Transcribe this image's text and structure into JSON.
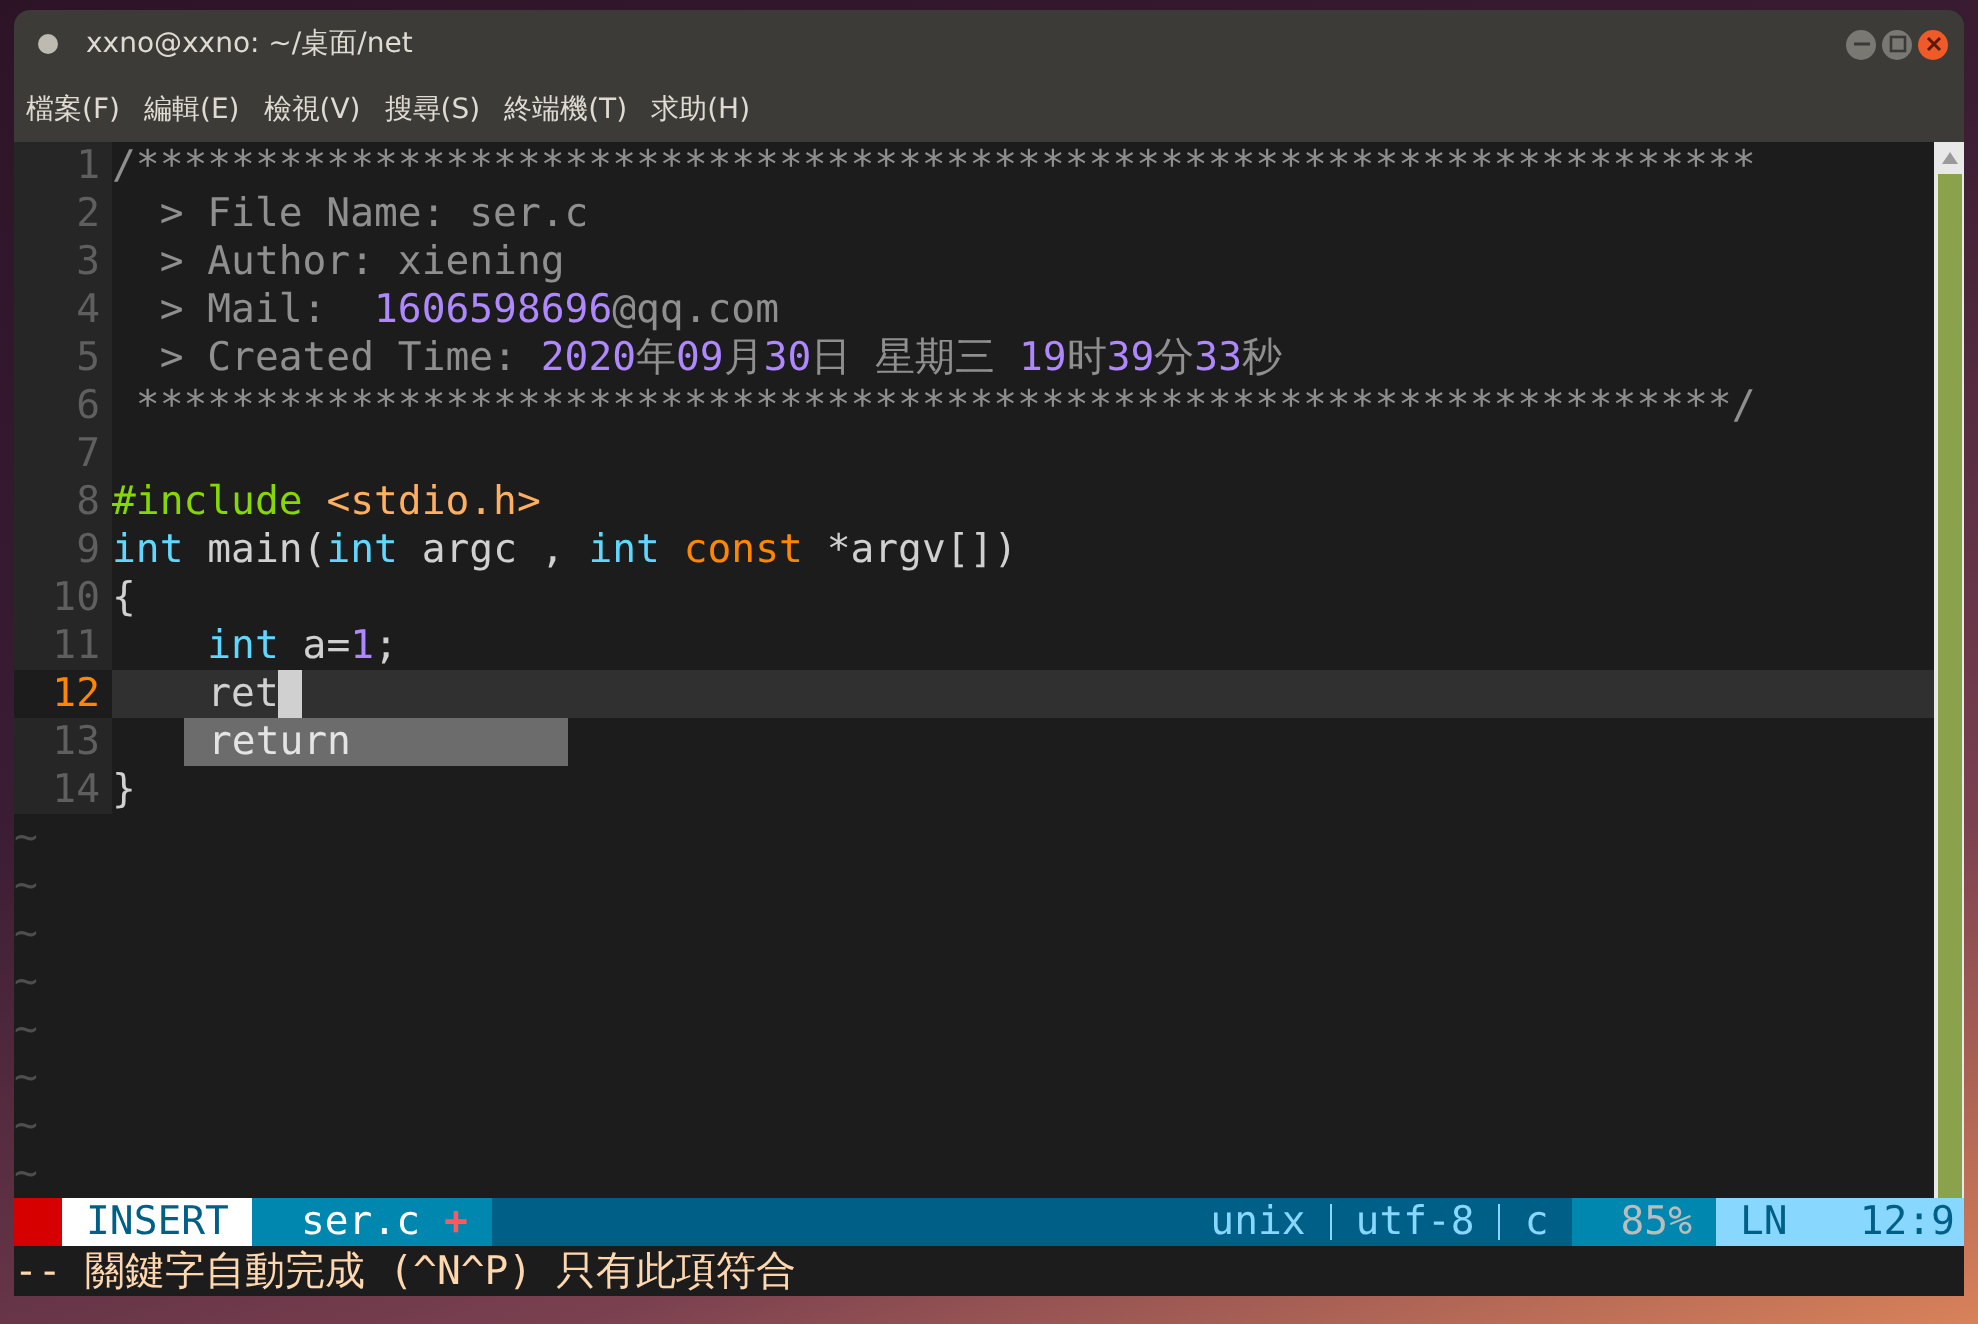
{
  "window": {
    "title": "xxno@xxno: ~/桌面/net"
  },
  "menu": [
    "檔案(F)",
    "編輯(E)",
    "檢視(V)",
    "搜尋(S)",
    "終端機(T)",
    "求助(H)"
  ],
  "editor": {
    "lines": [
      {
        "number": "1",
        "current": false,
        "segments": [
          {
            "kind": "comment",
            "text": "/********************************************************************"
          }
        ]
      },
      {
        "number": "2",
        "current": false,
        "segments": [
          {
            "kind": "comment",
            "text": "  > File Name: ser.c"
          }
        ]
      },
      {
        "number": "3",
        "current": false,
        "segments": [
          {
            "kind": "comment",
            "text": "  > Author: xiening"
          }
        ]
      },
      {
        "number": "4",
        "current": false,
        "segments": [
          {
            "kind": "comment",
            "text": "  > Mail:  "
          },
          {
            "kind": "number",
            "text": "1606598696"
          },
          {
            "kind": "comment",
            "text": "@qq.com"
          }
        ]
      },
      {
        "number": "5",
        "current": false,
        "segments": [
          {
            "kind": "comment",
            "text": "  > Created Time: "
          },
          {
            "kind": "number",
            "text": "2020"
          },
          {
            "kind": "comment",
            "text": "年"
          },
          {
            "kind": "number",
            "text": "09"
          },
          {
            "kind": "comment",
            "text": "月"
          },
          {
            "kind": "number",
            "text": "30"
          },
          {
            "kind": "comment",
            "text": "日 星期三 "
          },
          {
            "kind": "number",
            "text": "19"
          },
          {
            "kind": "comment",
            "text": "时"
          },
          {
            "kind": "number",
            "text": "39"
          },
          {
            "kind": "comment",
            "text": "分"
          },
          {
            "kind": "number",
            "text": "33"
          },
          {
            "kind": "comment",
            "text": "秒"
          }
        ]
      },
      {
        "number": "6",
        "current": false,
        "segments": [
          {
            "kind": "comment",
            "text": " *******************************************************************/"
          }
        ]
      },
      {
        "number": "7",
        "current": false
      },
      {
        "number": "8",
        "current": false,
        "segments": [
          {
            "kind": "preproc",
            "text": "#include "
          },
          {
            "kind": "include",
            "text": "<stdio.h>"
          }
        ]
      },
      {
        "number": "9",
        "current": false,
        "segments": [
          {
            "kind": "type",
            "text": "int"
          },
          {
            "kind": "plain",
            "text": " main("
          },
          {
            "kind": "type",
            "text": "int"
          },
          {
            "kind": "plain",
            "text": " argc , "
          },
          {
            "kind": "type",
            "text": "int"
          },
          {
            "kind": "storage",
            "text": " const"
          },
          {
            "kind": "plain",
            "text": " *argv[])"
          }
        ]
      },
      {
        "number": "10",
        "current": false,
        "segments": [
          {
            "kind": "plain",
            "text": "{"
          }
        ]
      },
      {
        "number": "11",
        "current": false,
        "segments": [
          {
            "kind": "type",
            "text": "    int"
          },
          {
            "kind": "plain",
            "text": " a="
          },
          {
            "kind": "number",
            "text": "1"
          },
          {
            "kind": "plain",
            "text": ";"
          }
        ]
      },
      {
        "number": "12",
        "current": true,
        "segments": [
          {
            "kind": "plain",
            "text": "    ret"
          }
        ]
      },
      {
        "number": "13",
        "current": false
      },
      {
        "number": "14",
        "current": false,
        "segments": [
          {
            "kind": "plain",
            "text": "}"
          }
        ]
      }
    ],
    "completion": {
      "items": [
        {
          "label": "return",
          "selected": false
        }
      ]
    },
    "tildes": [
      "~",
      "~",
      "~",
      "~",
      "~",
      "~",
      "~",
      "~"
    ]
  },
  "status_bar": {
    "mode": "INSERT",
    "file": "ser.c",
    "modified": "+",
    "fileformat": "unix",
    "encoding": "utf-8",
    "filetype": "c",
    "percent": "85%",
    "position_label": "LN",
    "position": "12:9"
  },
  "command_line": "-- 關鍵字自動完成 (^N^P) 只有此項符合"
}
